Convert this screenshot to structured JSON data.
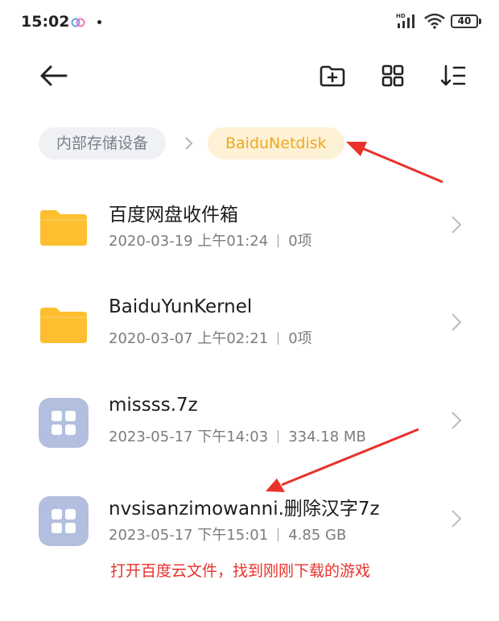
{
  "status_bar": {
    "time": "15:02",
    "battery": "40",
    "network_tag": "HD"
  },
  "toolbar": {
    "back_icon": "arrow-left-icon",
    "new_folder_icon": "folder-add-icon",
    "grid_view_icon": "grid-icon",
    "sort_icon": "sort-icon"
  },
  "breadcrumb": {
    "root": "内部存储设备",
    "current": "BaiduNetdisk"
  },
  "files": [
    {
      "name": "百度网盘收件箱",
      "date": "2020-03-19 上午01:24",
      "info": "0项",
      "type": "folder"
    },
    {
      "name": "BaiduYunKernel",
      "date": "2020-03-07 上午02:21",
      "info": "0项",
      "type": "folder"
    },
    {
      "name": "missss.7z",
      "date": "2023-05-17 下午14:03",
      "info": "334.18 MB",
      "type": "archive"
    },
    {
      "name": "nvsisanzimowanni.删除汉字7z",
      "date": "2023-05-17 下午15:01",
      "info": "4.85 GB",
      "type": "archive"
    }
  ],
  "annotation": "打开百度云文件，找到刚刚下载的游戏",
  "colors": {
    "folder": "#fdbf2f",
    "archive_tile": "#b3bfde",
    "breadcrumb_active_bg": "#fdf1d6",
    "breadcrumb_active_text": "#f0a81d",
    "annotation": "#e8322a"
  }
}
